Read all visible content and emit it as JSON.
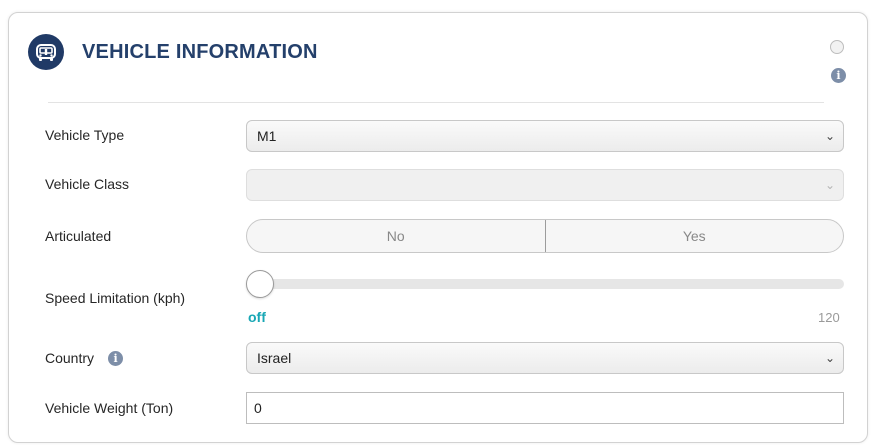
{
  "header": {
    "title": "VEHICLE INFORMATION",
    "icon": "vehicle-icon",
    "accent_color": "#203a66"
  },
  "vehicle_type": {
    "label": "Vehicle Type",
    "value": "M1"
  },
  "vehicle_class": {
    "label": "Vehicle Class",
    "value": "",
    "disabled": true
  },
  "articulated": {
    "label": "Articulated",
    "options": [
      "No",
      "Yes"
    ]
  },
  "speed_limitation": {
    "label": "Speed Limitation (kph)",
    "value_label": "off",
    "max_label": "120",
    "value_fraction": 0,
    "value_color": "#18a7b5"
  },
  "country": {
    "label": "Country",
    "value": "Israel",
    "info_icon": "info-icon"
  },
  "vehicle_weight": {
    "label": "Vehicle Weight (Ton)",
    "value": "0"
  }
}
